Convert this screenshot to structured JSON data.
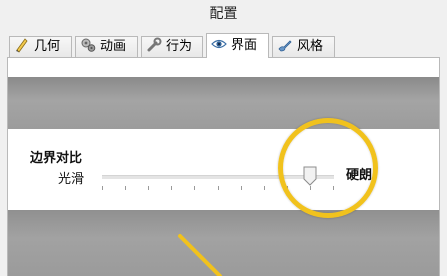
{
  "window": {
    "title": "配置"
  },
  "tabs": [
    {
      "label": "几何",
      "icon": "ruler-pencil-icon",
      "active": false
    },
    {
      "label": "动画",
      "icon": "gears-icon",
      "active": false
    },
    {
      "label": "行为",
      "icon": "wrench-icon",
      "active": false
    },
    {
      "label": "界面",
      "icon": "eye-icon",
      "active": true
    },
    {
      "label": "风格",
      "icon": "paint-brush-icon",
      "active": false
    }
  ],
  "settings": {
    "contrast_label": "边界对比",
    "min_label": "光滑",
    "max_label": "硬朗",
    "value_fraction": 0.895,
    "tick_count": 11
  },
  "colors": {
    "highlight": "#f1c21d",
    "demo_gray": "#9c9c9c"
  }
}
